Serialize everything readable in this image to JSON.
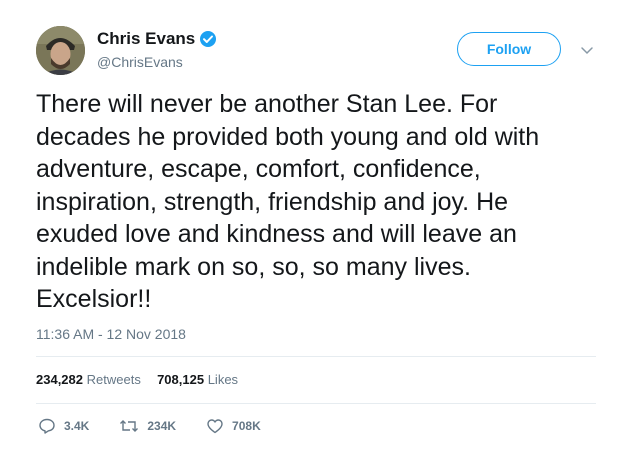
{
  "author": {
    "display_name": "Chris Evans",
    "handle": "@ChrisEvans",
    "verified": true
  },
  "follow_button": {
    "label": "Follow"
  },
  "tweet": {
    "text": "There will never be another Stan Lee. For\ndecades he provided both young and old with\nadventure, escape, comfort, confidence,\ninspiration, strength, friendship and joy. He\nexuded love and kindness and will leave an\nindelible mark on so, so, so many lives.\nExcelsior!!",
    "timestamp": "11:36 AM - 12 Nov 2018"
  },
  "stats": {
    "retweets_count": "234,282",
    "retweets_label": "Retweets",
    "likes_count": "708,125",
    "likes_label": "Likes"
  },
  "actions": {
    "reply_count": "3.4K",
    "retweet_count": "234K",
    "like_count": "708K"
  },
  "colors": {
    "accent": "#1da1f2",
    "muted": "#657786",
    "text": "#14171a",
    "divider": "#e6ecf0"
  }
}
